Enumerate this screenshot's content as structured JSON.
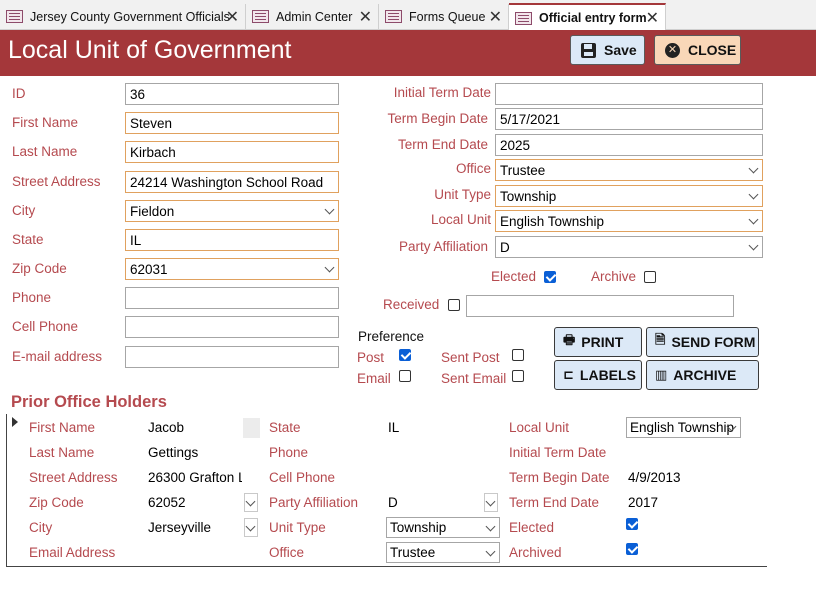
{
  "tabs": [
    {
      "label": "Jersey County Government Officials"
    },
    {
      "label": "Admin Center"
    },
    {
      "label": "Forms Queue"
    },
    {
      "label": "Official entry form"
    }
  ],
  "header": {
    "title": "Local Unit of Government",
    "save_label": "Save",
    "close_label": "CLOSE"
  },
  "left_fields": {
    "id": {
      "label": "ID",
      "value": "36"
    },
    "first_name": {
      "label": "First Name",
      "value": "Steven"
    },
    "last_name": {
      "label": "Last Name",
      "value": "Kirbach"
    },
    "street": {
      "label": "Street Address",
      "value": "24214 Washington School Road"
    },
    "city": {
      "label": "City",
      "value": "Fieldon"
    },
    "state": {
      "label": "State",
      "value": "IL"
    },
    "zip": {
      "label": "Zip Code",
      "value": "62031"
    },
    "phone": {
      "label": "Phone",
      "value": ""
    },
    "cell": {
      "label": "Cell Phone",
      "value": ""
    },
    "email": {
      "label": "E-mail address",
      "value": ""
    }
  },
  "right_fields": {
    "initial_term": {
      "label": "Initial Term Date",
      "value": ""
    },
    "term_begin": {
      "label": "Term Begin Date",
      "value": "5/17/2021"
    },
    "term_end": {
      "label": "Term End Date",
      "value": "2025"
    },
    "office": {
      "label": "Office",
      "value": "Trustee"
    },
    "unit_type": {
      "label": "Unit Type",
      "value": "Township"
    },
    "local_unit": {
      "label": "Local Unit",
      "value": "English Township"
    },
    "party": {
      "label": "Party Affiliation",
      "value": "D"
    }
  },
  "flags": {
    "elected_label": "Elected",
    "elected": true,
    "archive_label": "Archive",
    "archive": false,
    "received_label": "Received",
    "received": false,
    "received_value": ""
  },
  "preference": {
    "title": "Preference",
    "post_label": "Post",
    "post": true,
    "email_label": "Email",
    "email": false,
    "sent_post_label": "Sent Post",
    "sent_post": false,
    "sent_email_label": "Sent Email",
    "sent_email": false
  },
  "actions": {
    "print": "PRINT",
    "send_form": "SEND FORM",
    "labels": "LABELS",
    "archive": "ARCHIVE"
  },
  "prior": {
    "title": "Prior Office Holders",
    "first_name_label": "First Name",
    "first_name": "Jacob",
    "last_name_label": "Last Name",
    "last_name": "Gettings",
    "street_label": "Street Address",
    "street": "26300 Grafton L",
    "zip_label": "Zip Code",
    "zip": "62052",
    "city_label": "City",
    "city": "Jerseyville",
    "email_label": "Email Address",
    "email": "",
    "state_label": "State",
    "state": "IL",
    "phone_label": "Phone",
    "phone": "",
    "cell_label": "Cell Phone",
    "cell": "",
    "party_label": "Party Affiliation",
    "party": "D",
    "unit_type_label": "Unit Type",
    "unit_type": "Township",
    "office_label": "Office",
    "office": "Trustee",
    "local_unit_label": "Local Unit",
    "local_unit": "English Township",
    "initial_term_label": "Initial Term Date",
    "initial_term": "",
    "term_begin_label": "Term Begin Date",
    "term_begin": "4/9/2013",
    "term_end_label": "Term End Date",
    "term_end": "2017",
    "elected_label": "Elected",
    "elected": true,
    "archived_label": "Archived",
    "archived": true
  },
  "colors": {
    "header": "#a4373a",
    "label": "#b54a4f",
    "save_button": "#dce9f7",
    "close_button": "#f9d7b8",
    "checkbox_on": "#0a5fd6"
  }
}
